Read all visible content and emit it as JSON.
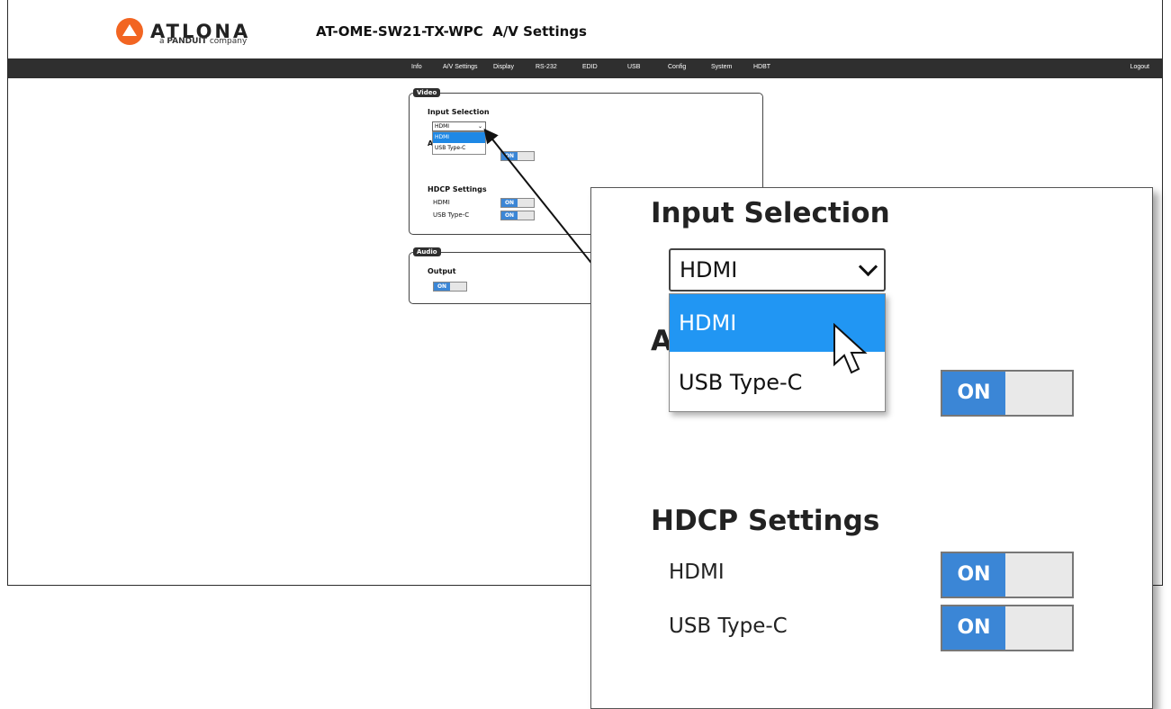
{
  "header": {
    "logo_text": "ATLONA",
    "logo_sub_prefix": "a",
    "logo_sub_brand": "PANDUIT",
    "logo_sub_suffix": "company",
    "title": "AT-OME-SW21-TX-WPC  A/V Settings"
  },
  "nav": {
    "items": [
      "Info",
      "A/V Settings",
      "Display",
      "RS-232",
      "EDID",
      "USB",
      "Config",
      "System",
      "HDBT"
    ],
    "logout": "Logout"
  },
  "video": {
    "legend": "Video",
    "input_selection_label": "Input Selection",
    "selected_value": "HDMI",
    "options": [
      "HDMI",
      "USB Type-C"
    ],
    "hidden_label_initial": "A",
    "auto_toggle": "ON",
    "hdcp_label": "HDCP Settings",
    "hdcp_items": [
      {
        "label": "HDMI",
        "state": "ON"
      },
      {
        "label": "USB Type-C",
        "state": "ON"
      }
    ]
  },
  "audio": {
    "legend": "Audio",
    "output_label": "Output",
    "output_toggle": "ON"
  },
  "zoom": {
    "input_selection_label": "Input Selection",
    "selected_value": "HDMI",
    "options": [
      "HDMI",
      "USB Type-C"
    ],
    "hidden_label_initial": "A",
    "auto_toggle": "ON",
    "hdcp_label": "HDCP Settings",
    "hdcp_items": [
      {
        "label": "HDMI",
        "state": "ON"
      },
      {
        "label": "USB Type-C",
        "state": "ON"
      }
    ]
  },
  "colors": {
    "accent_blue": "#3b86d6",
    "dropdown_selected": "#2196f3",
    "navbar": "#2f2f2f",
    "logo_orange": "#f26522"
  }
}
